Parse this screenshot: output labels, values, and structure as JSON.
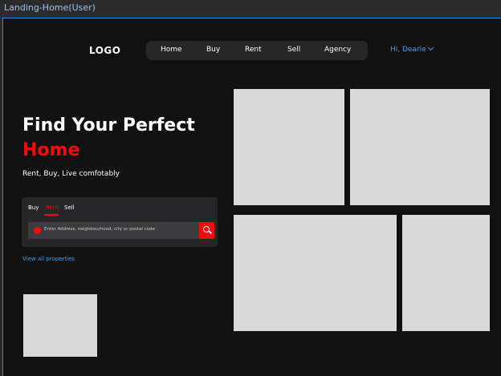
{
  "frame": {
    "title": "Landing-Home(User)"
  },
  "header": {
    "logo": "LOGO",
    "nav": [
      "Home",
      "Buy",
      "Rent",
      "Sell",
      "Agency"
    ],
    "greeting": "Hi, Dearie"
  },
  "hero": {
    "title_line1": "Find Your Perfect",
    "title_line2": "Home",
    "subtitle": "Rent, Buy, Live comfotably"
  },
  "search": {
    "tabs": [
      "Buy",
      "Rent",
      "Sell"
    ],
    "active_tab": "Rent",
    "placeholder": "Enter Address, neighbourhood, city or postal code"
  },
  "links": {
    "view_all": "View all properties"
  },
  "colors": {
    "accent_red": "#f20b0b",
    "link_blue": "#3d9ff0",
    "placeholder_gray": "#d9d9d9",
    "background": "#111112"
  }
}
